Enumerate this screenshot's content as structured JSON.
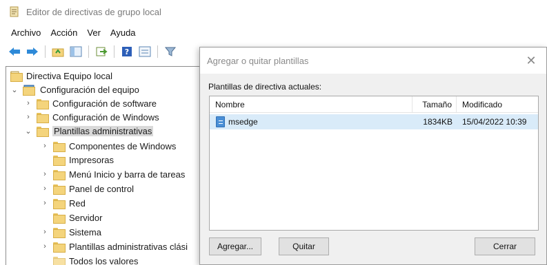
{
  "window": {
    "title": "Editor de directivas de grupo local"
  },
  "menu": [
    "Archivo",
    "Acción",
    "Ver",
    "Ayuda"
  ],
  "tree": {
    "root": "Directiva Equipo local",
    "computer_config": "Configuración del equipo",
    "software_config": "Configuración de software",
    "windows_config": "Configuración de Windows",
    "admin_templates": "Plantillas administrativas",
    "children": [
      "Componentes de Windows",
      "Impresoras",
      "Menú Inicio y barra de tareas",
      "Panel de control",
      "Red",
      "Servidor",
      "Sistema",
      "Plantillas administrativas clási",
      "Todos los valores"
    ]
  },
  "dialog": {
    "title": "Agregar o quitar plantillas",
    "close_glyph": "✕",
    "label": "Plantillas de directiva actuales:",
    "columns": {
      "name": "Nombre",
      "size": "Tamaño",
      "modified": "Modificado"
    },
    "rows": [
      {
        "name": "msedge",
        "size": "1834KB",
        "modified": "15/04/2022 10:39"
      }
    ],
    "buttons": {
      "add": "Agregar...",
      "remove": "Quitar",
      "close": "Cerrar"
    }
  },
  "colors": {
    "selection": "#d9ebf9",
    "folder": "#f4d47c",
    "dialog_bg": "#f0f0f0"
  }
}
